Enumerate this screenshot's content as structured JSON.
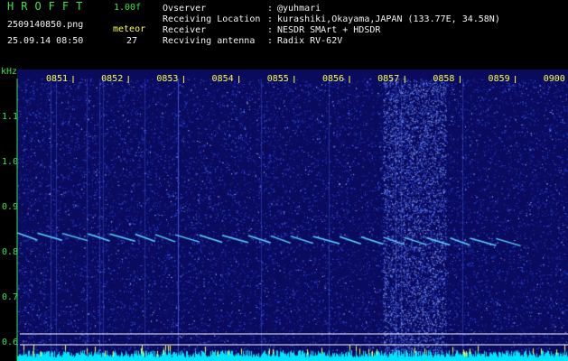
{
  "header": {
    "app_title": "HROFFT",
    "version": "1.00f",
    "filename": "2509140850.png",
    "datetime": "25.09.14 08:50",
    "meteor_label": "meteor",
    "meteor_count": "27"
  },
  "info": {
    "observer_label": "Ovserver",
    "observer_value": "@yuhmari",
    "location_label": "Receiving Location",
    "location_value": "kurashiki,Okayama,JAPAN (133.77E, 34.58N)",
    "receiver_label": "Receiver",
    "receiver_value": "NESDR SMArt + HDSDR",
    "antenna_label": "Recviving antenna",
    "antenna_value": "Radix RV-62V",
    "colon": ":"
  },
  "plot": {
    "y_unit": "kHz",
    "y_ticks": [
      "1.1",
      "1.0",
      "0.9",
      "0.8",
      "0.7",
      "0.6"
    ],
    "x_ticks": [
      "0851",
      "0852",
      "0853",
      "0854",
      "0855",
      "0856",
      "0857",
      "0858",
      "0859",
      "0900"
    ],
    "colors": {
      "background": "#0a0a5e",
      "noise": "#2f52ff",
      "trace": "#57d8ff",
      "tick_label": "#ffff3c",
      "axis_label": "#3ee24a",
      "baseline": "#f2f2f2"
    }
  }
}
